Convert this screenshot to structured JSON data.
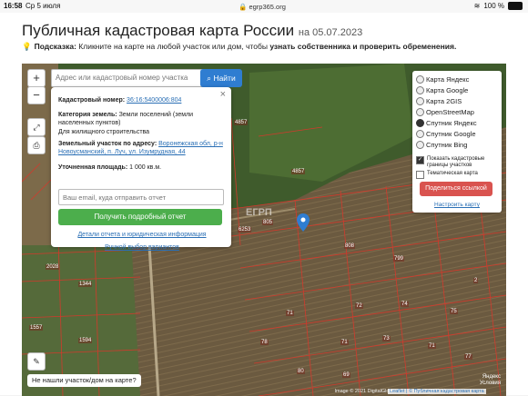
{
  "status_bar": {
    "time": "16:58",
    "date": "Ср 5 июля",
    "url": "egrp365.org",
    "battery": "100 %"
  },
  "header": {
    "title": "Публичная кадастровая карта России",
    "date": "на 05.07.2023"
  },
  "hint": {
    "label": "Подсказка:",
    "text": "Кликните на карте на любой участок или дом, чтобы",
    "bold": "узнать собственника и проверить обременения."
  },
  "map": {
    "zoom_in": "+",
    "zoom_out": "−",
    "search": {
      "placeholder": "Адрес или кадастровый номер участка"
    },
    "find_label": "Найти",
    "not_found": "Не нашли участок/дом на карте?",
    "attribution": "Image © 2021 DigitalGlobe, Inc., Image © 2021 Maxar",
    "leaflet": "Leaflet | © Публичная кадастровая карта",
    "yandex": [
      "Яндекс",
      "Условия"
    ],
    "watermark": "ЕГРП",
    "parcel_labels": [
      "4857",
      "4857",
      "6253",
      "805",
      "808",
      "799",
      "2028",
      "1344",
      "1557",
      "1594",
      "2",
      "71",
      "78",
      "71",
      "69",
      "80",
      "73",
      "72",
      "74",
      "75",
      "71",
      "77"
    ]
  },
  "popup": {
    "close": "×",
    "cadastral_label": "Кадастровый номер:",
    "cadastral_value": "36:16:5400006:804",
    "category_label": "Категория земель:",
    "category_value": "Земли поселений (земли населенных пунктов)",
    "purpose": "Для жилищного строительства",
    "address_label": "Земельный участок по адресу:",
    "address_value": "Воронежская обл, р-н Новоусманский, п. Луч, ул. Изумрудная, 44",
    "area_label": "Уточненная площадь:",
    "area_value": "1 000 кв.м.",
    "email_placeholder": "Ваш email, куда отправить отчет",
    "get_report": "Получить подробный отчет",
    "details_link": "Детали отчета и юридическая информация",
    "manual_link": "Ручной выбор вариантов"
  },
  "layers": {
    "options": [
      "Карта Яндекс",
      "Карта Google",
      "Карта 2GIS",
      "OpenStreetMap",
      "Спутник Яндекс",
      "Спутник Google",
      "Спутник Bing"
    ],
    "selected_index": 4,
    "show_borders": "Показать кадастровые границы участков",
    "show_borders_checked": true,
    "thematic": "Тематическая карта",
    "thematic_checked": false,
    "share": "Поделиться ссылкой",
    "setup": "Настроить карту"
  },
  "colors": {
    "accent_blue": "#2f7dd1",
    "green": "#4cae4c",
    "red": "#d9534f",
    "parcel_border": "#c0392b"
  }
}
